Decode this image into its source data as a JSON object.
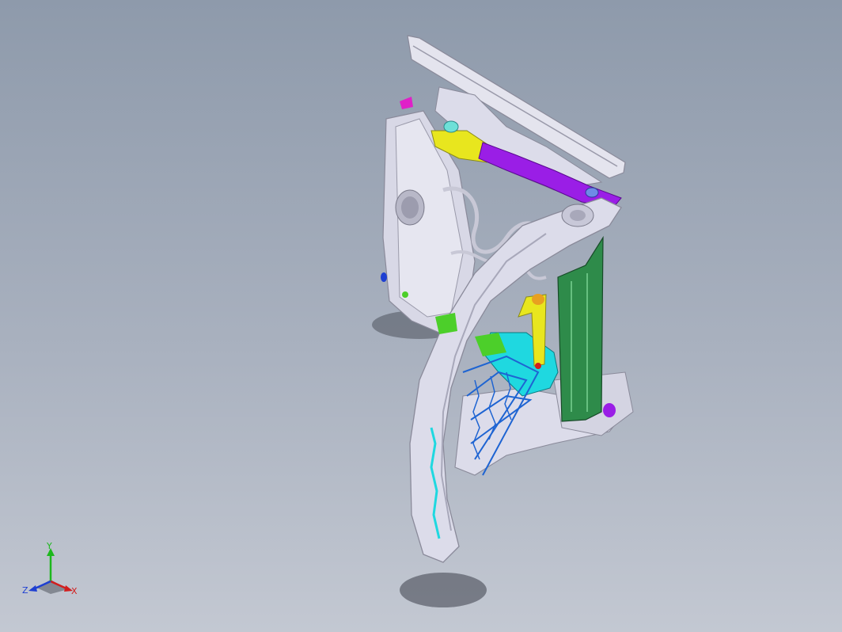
{
  "viewport": {
    "background_top": "#8e9aab",
    "background_bottom": "#c3c8d2"
  },
  "model": {
    "colors": {
      "frame": "#dcdcea",
      "frame_edge": "#8a8a9a",
      "purple": "#9a1ee6",
      "yellow": "#e8e61e",
      "green": "#2e8b4a",
      "cyan": "#1fd8e0",
      "blue": "#1e64d2",
      "lime": "#4ccf2a",
      "magenta": "#e020c8",
      "orange": "#e8a020"
    }
  },
  "triad": {
    "y_label": "Y",
    "z_label": "Z",
    "x_label": "X",
    "y_color": "#1db81d",
    "z_color": "#1e3fd2",
    "x_color": "#d21e1e"
  }
}
